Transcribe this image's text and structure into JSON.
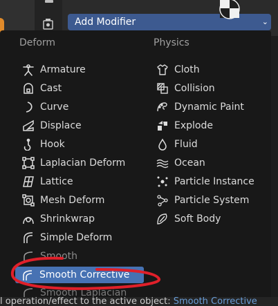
{
  "header": {
    "add_modifier_label": "Add Modifier",
    "chevron": "⌄"
  },
  "columns": {
    "deform_header": "Deform",
    "physics_header": "Physics"
  },
  "deform_items": [
    {
      "label": "Armature",
      "icon": "armature-icon"
    },
    {
      "label": "Cast",
      "icon": "cast-icon"
    },
    {
      "label": "Curve",
      "icon": "curve-icon"
    },
    {
      "label": "Displace",
      "icon": "displace-icon"
    },
    {
      "label": "Hook",
      "icon": "hook-icon"
    },
    {
      "label": "Laplacian Deform",
      "icon": "laplacian-deform-icon"
    },
    {
      "label": "Lattice",
      "icon": "lattice-icon"
    },
    {
      "label": "Mesh Deform",
      "icon": "mesh-deform-icon"
    },
    {
      "label": "Shrinkwrap",
      "icon": "shrinkwrap-icon"
    },
    {
      "label": "Simple Deform",
      "icon": "simple-deform-icon"
    },
    {
      "label": "Smooth",
      "icon": "smooth-icon"
    },
    {
      "label": "Smooth Corrective",
      "icon": "smooth-corrective-icon"
    },
    {
      "label": "Smooth Laplacian",
      "icon": "smooth-laplacian-icon"
    }
  ],
  "physics_items": [
    {
      "label": "Cloth",
      "icon": "cloth-icon"
    },
    {
      "label": "Collision",
      "icon": "collision-icon"
    },
    {
      "label": "Dynamic Paint",
      "icon": "dynamic-paint-icon"
    },
    {
      "label": "Explode",
      "icon": "explode-icon"
    },
    {
      "label": "Fluid",
      "icon": "fluid-icon"
    },
    {
      "label": "Ocean",
      "icon": "ocean-icon"
    },
    {
      "label": "Particle Instance",
      "icon": "particle-instance-icon"
    },
    {
      "label": "Particle System",
      "icon": "particle-system-icon"
    },
    {
      "label": "Soft Body",
      "icon": "soft-body-icon"
    }
  ],
  "selected_item": "Smooth Corrective",
  "status_bar": {
    "text": "l operation/effect to the active object:",
    "highlight": "Smooth Corrective"
  },
  "colors": {
    "accent": "#4772b3",
    "header_button": "#3d5a90",
    "annotation": "#e0202a",
    "menu_bg": "#181818"
  }
}
